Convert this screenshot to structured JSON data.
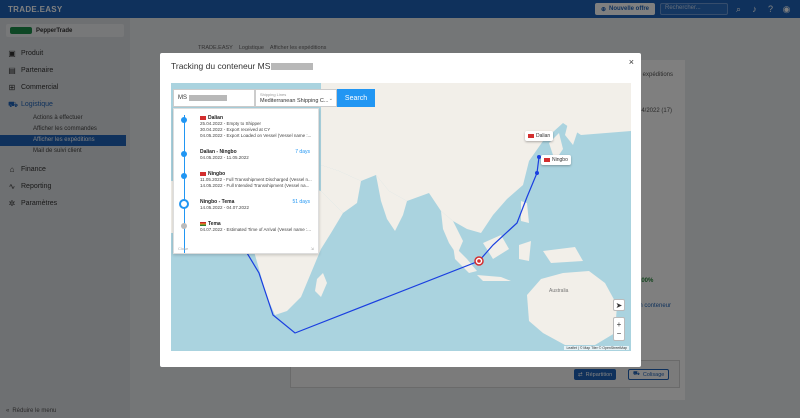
{
  "app": {
    "brand": "TRADE.EASY"
  },
  "topbar": {
    "new_offer_label": "Nouvelle offre",
    "search_placeholder": "Rechercher...",
    "icons": [
      "plus-circle-icon",
      "search-icon",
      "bell-icon",
      "help-icon",
      "user-icon"
    ]
  },
  "sidebar": {
    "company": "PepperTrade",
    "items": [
      {
        "label": "Produit",
        "icon": "box-icon"
      },
      {
        "label": "Partenaire",
        "icon": "building-icon"
      },
      {
        "label": "Commercial",
        "icon": "cart-icon"
      },
      {
        "label": "Logistique",
        "icon": "truck-icon",
        "active": true
      },
      {
        "label": "Finance",
        "icon": "bank-icon"
      },
      {
        "label": "Reporting",
        "icon": "chart-icon"
      },
      {
        "label": "Paramètres",
        "icon": "gear-icon"
      }
    ],
    "sub_items": [
      "Actions à effectuer",
      "Afficher les commandes",
      "Afficher les expéditions",
      "Mail de suivi client"
    ],
    "collapse_label": "Réduire le menu"
  },
  "breadcrumb": [
    "TRADE.EASY",
    "Logistique",
    "Afficher les expéditions"
  ],
  "background": {
    "side_title": "s expéditions",
    "date_text": "04/2022 (17)",
    "percent": "100%",
    "link_text": "in conteneur",
    "btn_repartition": "Répartition",
    "btn_collisage": "Colisage"
  },
  "modal": {
    "title": "Tracking du conteneur MS",
    "search": {
      "container_value": "MS",
      "shipping_line_label": "Shipping Lines",
      "shipping_line_value": "Mediterranean Shipping C...",
      "button_label": "Search"
    },
    "timeline": [
      {
        "type": "port",
        "title": "Dalian",
        "lines": [
          "25.04.2022 - Empty to Shipper",
          "30.04.2022 - Export received at CY",
          "04.05.2022 - Export Loaded on Vessel (Vessel name :..."
        ]
      },
      {
        "type": "leg",
        "title": "Dalian - Ningbo",
        "lines": [
          "04.05.2022 - 11.05.2022"
        ],
        "days": "7 days"
      },
      {
        "type": "port",
        "title": "Ningbo",
        "lines": [
          "11.05.2022 - Full Transshipment Discharged (Vessel n...",
          "14.05.2022 - Full Intended Transshipment (Vessel na..."
        ]
      },
      {
        "type": "leg",
        "title": "Ningbo - Tema",
        "lines": [
          "14.05.2022 - 04.07.2022"
        ],
        "days": "51 days"
      },
      {
        "type": "port",
        "title": "Tema",
        "lines": [
          "04.07.2022 - Estimated Time of Arrival (Vessel name :..."
        ]
      }
    ],
    "timeline_footer_left": "Close",
    "map_labels": {
      "dalian": "Dalian",
      "ningbo": "Ningbo",
      "australia": "Australia",
      "attribution": "Leaflet | © Map Tiler © OpenStreetMap"
    }
  },
  "colors": {
    "primary": "#1e63b8",
    "accent": "#2196f3",
    "route": "#1a3fe0",
    "ocean": "#aad3df",
    "land": "#f2efe9"
  }
}
